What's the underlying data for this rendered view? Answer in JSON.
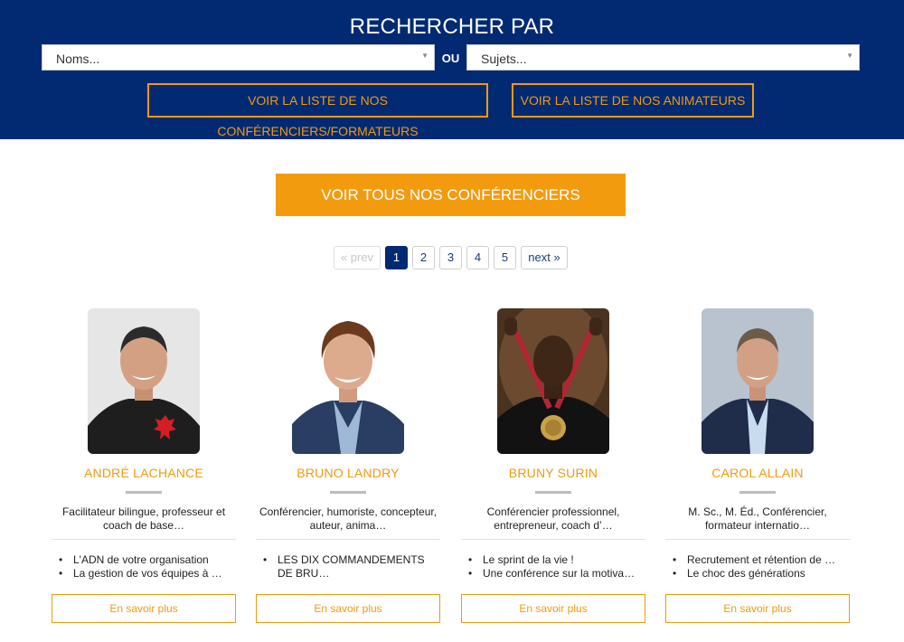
{
  "search": {
    "title": "RECHERCHER PAR",
    "names_placeholder": "Noms...",
    "or_label": "OU",
    "subjects_placeholder": "Sujets...",
    "speakers_list_button": "VOIR LA LISTE DE NOS CONFÉRENCIERS/FORMATEURS",
    "hosts_list_button": "VOIR LA LISTE DE NOS ANIMATEURS"
  },
  "cta": {
    "label": "VOIR TOUS NOS CONFÉRENCIERS"
  },
  "pagination": {
    "prev": "« prev",
    "pages": [
      "1",
      "2",
      "3",
      "4",
      "5"
    ],
    "current": "1",
    "next": "next »"
  },
  "speakers": [
    {
      "name": "ANDRÉ LACHANCE",
      "description": "Facilitateur bilingue, professeur et coach de base…",
      "topics": [
        "L'ADN de votre organisation",
        "La gestion de vos équipes à …"
      ],
      "more_label": "En savoir plus"
    },
    {
      "name": "BRUNO LANDRY",
      "description": "Conférencier, humoriste, concepteur, auteur, anima…",
      "topics": [
        "LES DIX COMMANDEMENTS DE BRU…"
      ],
      "more_label": "En savoir plus"
    },
    {
      "name": "BRUNY SURIN",
      "description": "Conférencier professionnel, entrepreneur, coach d’…",
      "topics": [
        "Le sprint de la vie !",
        "Une conférence sur la motiva…"
      ],
      "more_label": "En savoir plus"
    },
    {
      "name": "CAROL ALLAIN",
      "description": "M. Sc., M. Éd., Conférencier, formateur internatio…",
      "topics": [
        "Recrutement et rétention de …",
        "Le choc des générations"
      ],
      "more_label": "En savoir plus"
    }
  ],
  "colors": {
    "header_bg": "#012a72",
    "accent_orange": "#f39b0f",
    "active_page": "#012a72"
  }
}
